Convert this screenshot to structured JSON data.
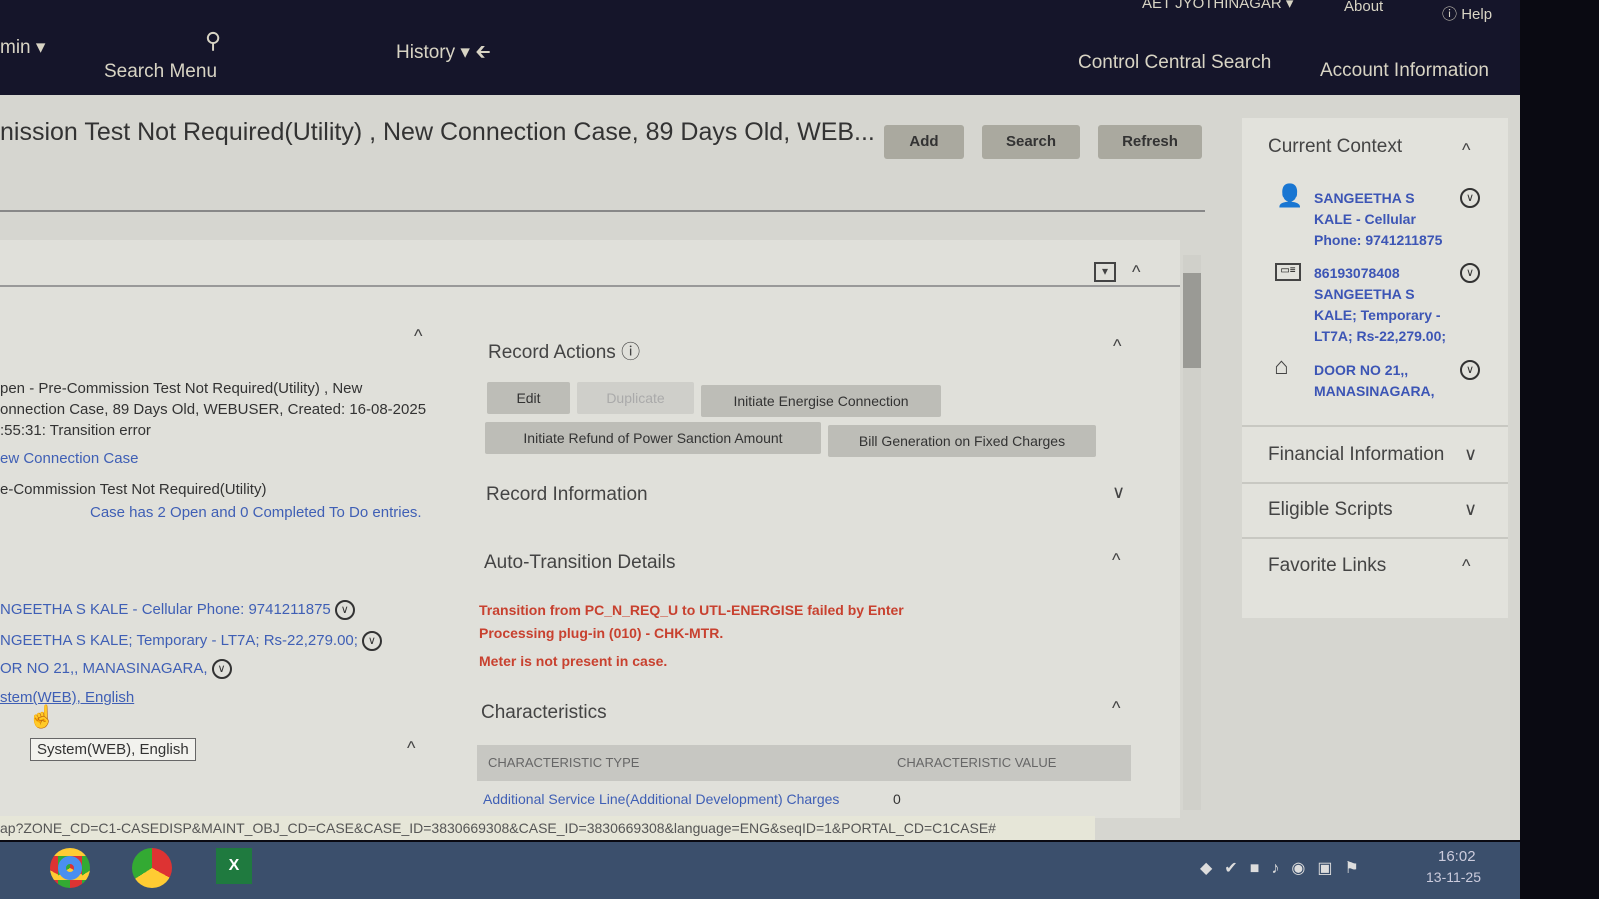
{
  "topbar": {
    "admin": "min",
    "search_menu": "Search Menu",
    "history": "History",
    "office": "AET JYOTHINAGAR",
    "about": "About",
    "help": "Help",
    "control_central": "Control Central Search",
    "account_info": "Account Information"
  },
  "page": {
    "title": "nission Test Not Required(Utility) , New Connection Case, 89 Days Old, WEB...",
    "add": "Add",
    "search": "Search",
    "refresh": "Refresh"
  },
  "left": {
    "summary_1": "pen - Pre-Commission Test Not Required(Utility) , New",
    "summary_2": "onnection Case, 89 Days Old, WEBUSER, Created: 16-08-2025",
    "summary_3": ":55:31: Transition error",
    "case_type": "ew Connection Case",
    "status": "e-Commission Test Not Required(Utility)",
    "todo": "Case has 2 Open and 0 Completed To Do entries.",
    "person": "NGEETHA S KALE - Cellular Phone: 9741211875",
    "account": "NGEETHA S KALE; Temporary - LT7A; Rs-22,279.00;",
    "premise": "OR NO 21,, MANASINAGARA,",
    "user": "stem(WEB), English",
    "tooltip": "System(WEB), English"
  },
  "record_actions": {
    "title": "Record Actions",
    "edit": "Edit",
    "duplicate": "Duplicate",
    "energise": "Initiate Energise Connection",
    "refund": "Initiate Refund of Power Sanction Amount",
    "bill": "Bill Generation on Fixed Charges"
  },
  "sections": {
    "record_info": "Record Information",
    "auto_transition": "Auto-Transition Details",
    "characteristics": "Characteristics"
  },
  "auto_transition": {
    "msg1": "Transition from PC_N_REQ_U to UTL-ENERGISE failed by Enter",
    "msg2": "Processing plug-in (010) - CHK-MTR.",
    "msg3": "Meter is not present in case."
  },
  "char_table": {
    "headers": [
      "CHARACTERISTIC TYPE",
      "CHARACTERISTIC VALUE"
    ],
    "rows": [
      {
        "type": "Additional Service Line(Additional Development) Charges",
        "value": "0"
      }
    ]
  },
  "context": {
    "title": "Current Context",
    "person": "SANGEETHA S KALE - Cellular Phone: 9741211875",
    "account": "86193078408 SANGEETHA S KALE; Temporary - LT7A; Rs-22,279.00;",
    "premise": "DOOR NO 21,, MANASINAGARA,",
    "financial": "Financial Information",
    "scripts": "Eligible Scripts",
    "favorites": "Favorite Links"
  },
  "status_url": "ap?ZONE_CD=C1-CASEDISP&MAINT_OBJ_CD=CASE&CASE_ID=3830669308&CASE_ID=3830669308&language=ENG&seqID=1&PORTAL_CD=C1CASE#",
  "clock": {
    "time": "16:02",
    "date": "13-11-25"
  }
}
